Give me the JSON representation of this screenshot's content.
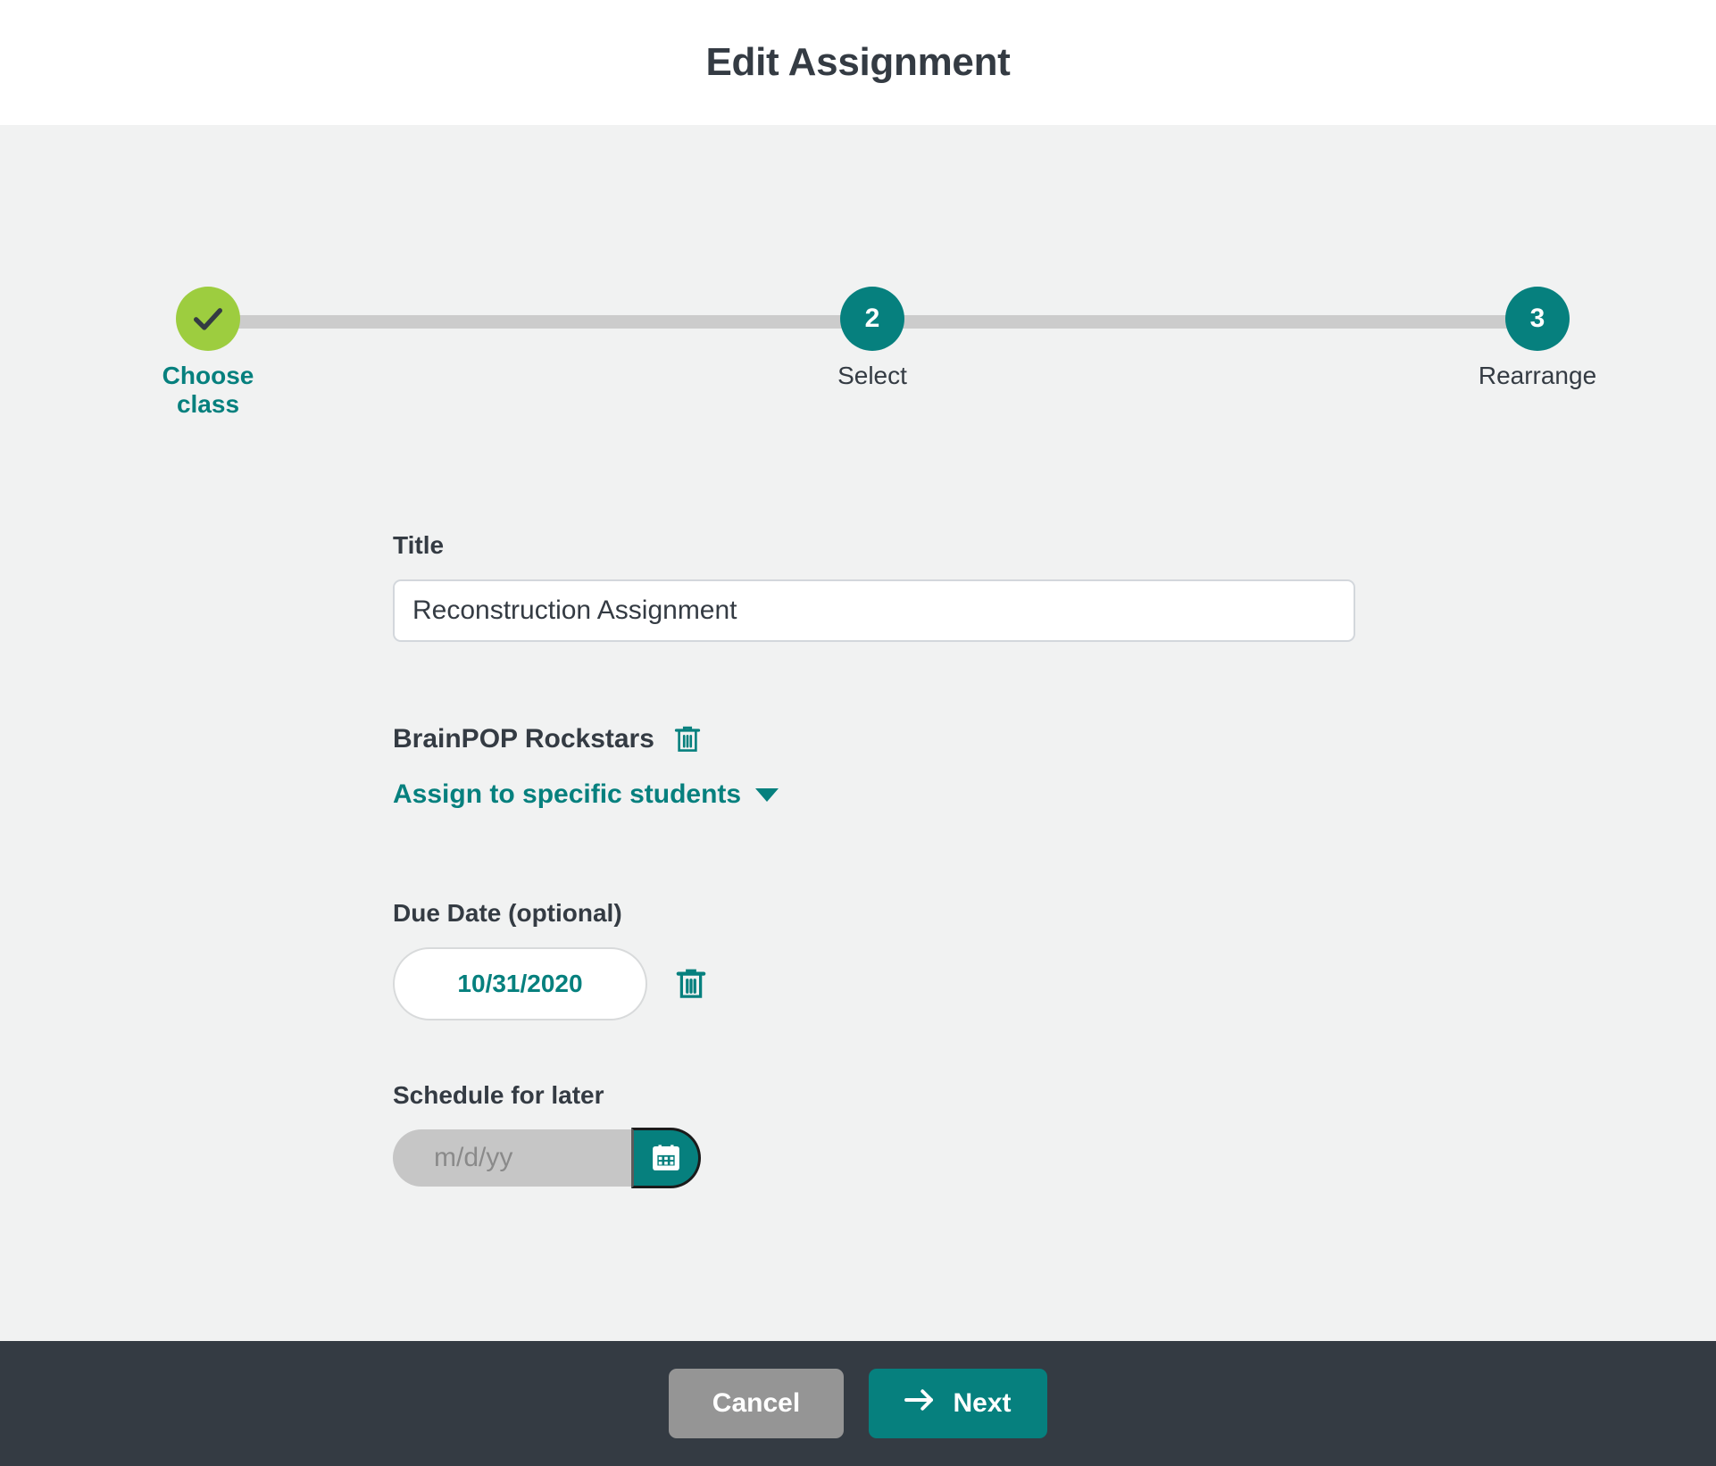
{
  "header": {
    "title": "Edit Assignment"
  },
  "stepper": {
    "steps": [
      {
        "marker": "✓",
        "label": "Choose class",
        "state": "done"
      },
      {
        "marker": "2",
        "label": "Select",
        "state": "active"
      },
      {
        "marker": "3",
        "label": "Rearrange",
        "state": "upcoming"
      }
    ]
  },
  "form": {
    "title_field": {
      "label": "Title",
      "value": "Reconstruction Assignment",
      "placeholder": "Title"
    },
    "class_section": {
      "class_name": "BrainPOP Rockstars",
      "delete_icon": "trash-icon",
      "assign_link": "Assign to specific students",
      "caret_icon": "chevron-down-icon"
    },
    "due_date": {
      "label": "Due Date (optional)",
      "value": "10/31/2020",
      "delete_icon": "trash-icon"
    },
    "schedule": {
      "label": "Schedule for later",
      "value": "",
      "placeholder": "m/d/yy",
      "calendar_icon": "calendar-icon"
    }
  },
  "footer": {
    "cancel_label": "Cancel",
    "next_label": "Next",
    "next_icon": "arrow-right-icon"
  },
  "colors": {
    "teal": "#06807e",
    "green": "#9dcd3f",
    "dark_slate": "#343b43",
    "page_bg": "#f1f2f2",
    "track_gray": "#cccccc",
    "cancel_gray": "#959595"
  }
}
